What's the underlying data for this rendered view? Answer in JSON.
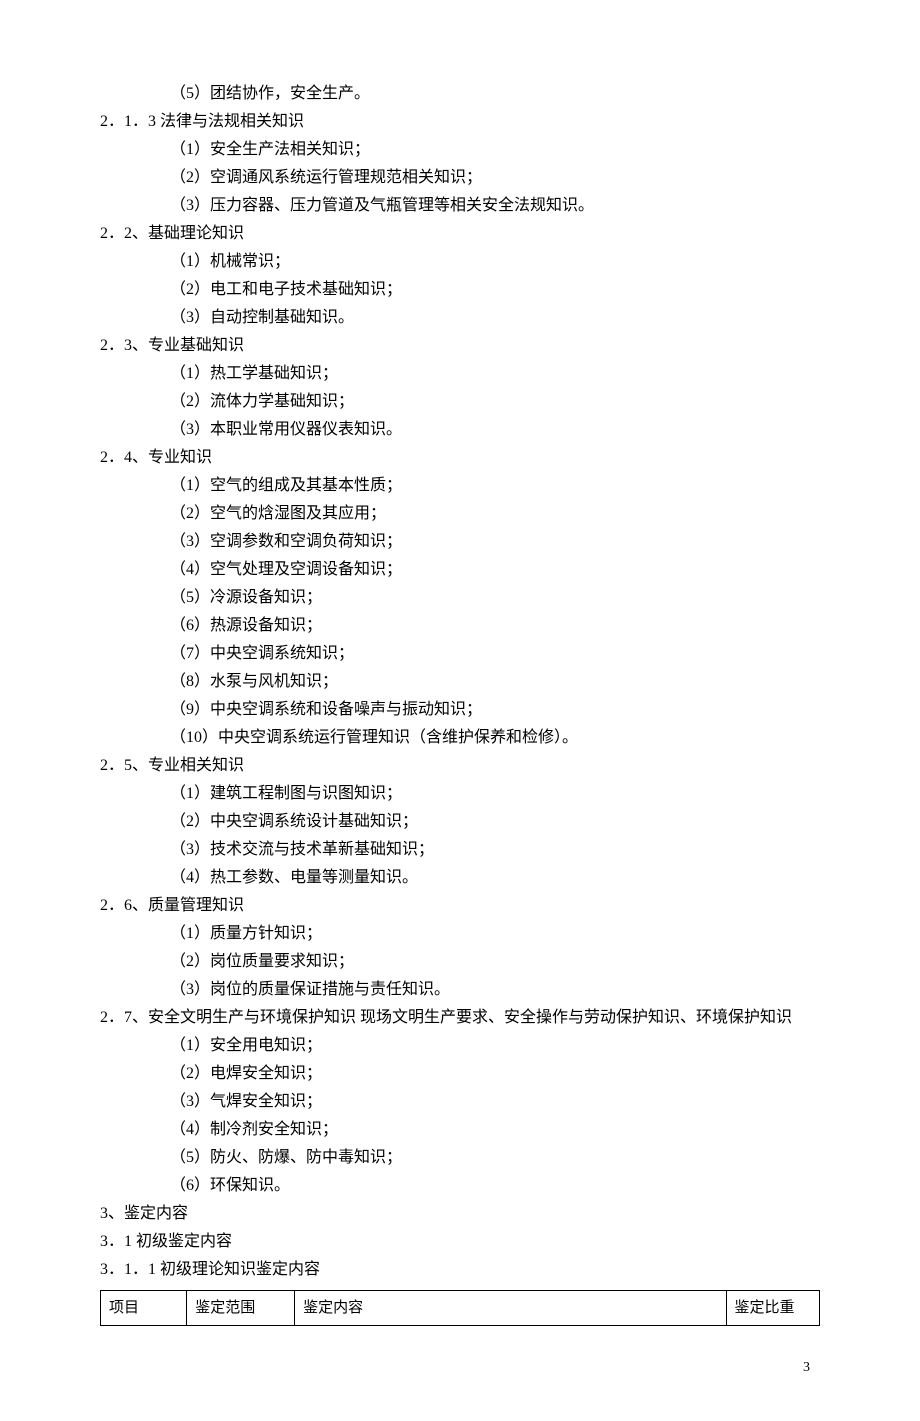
{
  "lines": [
    {
      "cls": "indent-1",
      "text": "（5）团结协作，安全生产。"
    },
    {
      "cls": "indent-0",
      "text": "2．1．3 法律与法规相关知识"
    },
    {
      "cls": "indent-1",
      "text": "（1）安全生产法相关知识；"
    },
    {
      "cls": "indent-1",
      "text": "（2）空调通风系统运行管理规范相关知识；"
    },
    {
      "cls": "indent-1",
      "text": "（3）压力容器、压力管道及气瓶管理等相关安全法规知识。"
    },
    {
      "cls": "indent-0",
      "text": "2．2、基础理论知识"
    },
    {
      "cls": "indent-1",
      "text": "（1）机械常识；"
    },
    {
      "cls": "indent-1",
      "text": "（2）电工和电子技术基础知识；"
    },
    {
      "cls": "indent-1",
      "text": "（3）自动控制基础知识。"
    },
    {
      "cls": "indent-0",
      "text": "2．3、专业基础知识"
    },
    {
      "cls": "indent-1",
      "text": "（1）热工学基础知识；"
    },
    {
      "cls": "indent-1",
      "text": "（2）流体力学基础知识；"
    },
    {
      "cls": "indent-1",
      "text": "（3）本职业常用仪器仪表知识。"
    },
    {
      "cls": "indent-0",
      "text": "2．4、专业知识"
    },
    {
      "cls": "indent-1",
      "text": "（1）空气的组成及其基本性质；"
    },
    {
      "cls": "indent-1",
      "text": "（2）空气的焓湿图及其应用；"
    },
    {
      "cls": "indent-1",
      "text": "（3）空调参数和空调负荷知识；"
    },
    {
      "cls": "indent-1",
      "text": "（4）空气处理及空调设备知识；"
    },
    {
      "cls": "indent-1",
      "text": "（5）冷源设备知识；"
    },
    {
      "cls": "indent-1",
      "text": "（6）热源设备知识；"
    },
    {
      "cls": "indent-1",
      "text": "（7）中央空调系统知识；"
    },
    {
      "cls": "indent-1",
      "text": "（8）水泵与风机知识；"
    },
    {
      "cls": "indent-1",
      "text": "（9）中央空调系统和设备噪声与振动知识；"
    },
    {
      "cls": "indent-1",
      "text": "（10）中央空调系统运行管理知识（含维护保养和检修）。"
    },
    {
      "cls": "indent-0",
      "text": "2．5、专业相关知识"
    },
    {
      "cls": "indent-1",
      "text": "（1）建筑工程制图与识图知识；"
    },
    {
      "cls": "indent-1",
      "text": "（2）中央空调系统设计基础知识；"
    },
    {
      "cls": "indent-1",
      "text": "（3）技术交流与技术革新基础知识；"
    },
    {
      "cls": "indent-1",
      "text": "（4）热工参数、电量等测量知识。"
    },
    {
      "cls": "indent-0",
      "text": "2．6、质量管理知识"
    },
    {
      "cls": "indent-1",
      "text": "（1）质量方针知识；"
    },
    {
      "cls": "indent-1",
      "text": "（2）岗位质量要求知识；"
    },
    {
      "cls": "indent-1",
      "text": "（3）岗位的质量保证措施与责任知识。"
    },
    {
      "cls": "indent-0",
      "text": "2．7、安全文明生产与环境保护知识 现场文明生产要求、安全操作与劳动保护知识、环境保护知识"
    },
    {
      "cls": "indent-1",
      "text": "（1）安全用电知识；"
    },
    {
      "cls": "indent-1",
      "text": "（2）电焊安全知识；"
    },
    {
      "cls": "indent-1",
      "text": "（3）气焊安全知识；"
    },
    {
      "cls": "indent-1",
      "text": "（4）制冷剂安全知识；"
    },
    {
      "cls": "indent-1",
      "text": "（5）防火、防爆、防中毒知识；"
    },
    {
      "cls": "indent-1",
      "text": "（6）环保知识。"
    },
    {
      "cls": "indent-0",
      "text": "3、鉴定内容"
    },
    {
      "cls": "indent-0",
      "text": "3．1 初级鉴定内容"
    },
    {
      "cls": "indent-0",
      "text": "3．1．1 初级理论知识鉴定内容"
    }
  ],
  "table": {
    "headers": [
      "项目",
      "鉴定范围",
      "鉴定内容",
      "鉴定比重"
    ]
  },
  "page_number": "3"
}
